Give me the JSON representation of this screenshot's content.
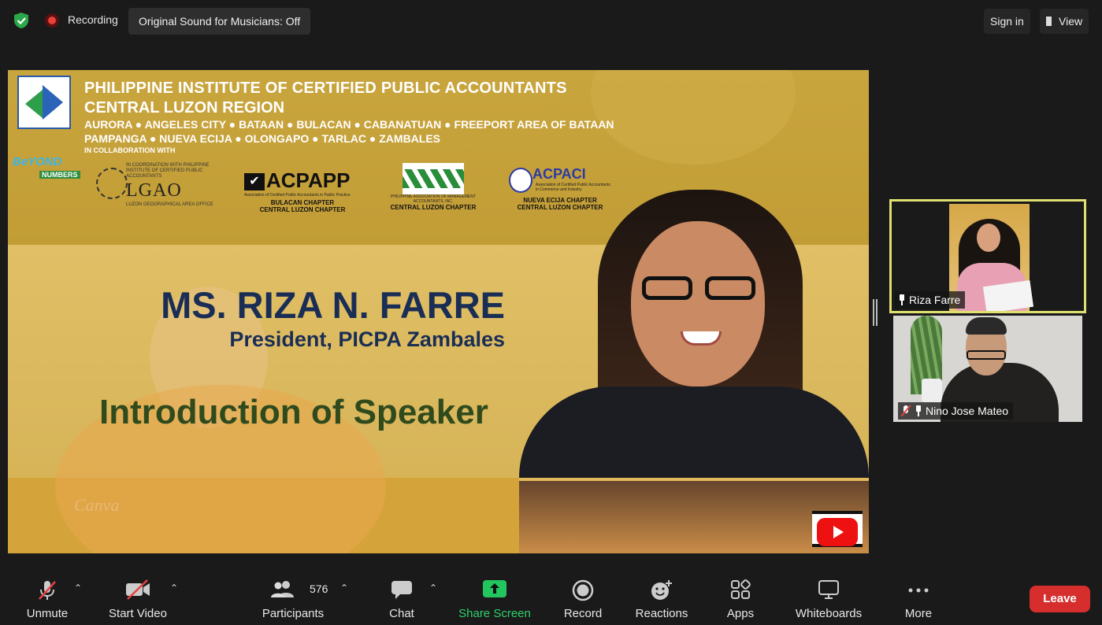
{
  "topbar": {
    "recording_label": "Recording",
    "original_sound": "Original Sound for Musicians: Off",
    "sign_in": "Sign in",
    "view": "View"
  },
  "slide": {
    "org_line1": "PHILIPPINE INSTITUTE OF CERTIFIED PUBLIC ACCOUNTANTS",
    "org_line2": "CENTRAL LUZON REGION",
    "chapters_line1": "AURORA ● ANGELES CITY ● BATAAN ● BULACAN ● CABANATUAN ● FREEPORT AREA OF BATAAN",
    "chapters_line2": "PAMPANGA ● NUEVA ECIJA ● OLONGAPO ● TARLAC ● ZAMBALES",
    "collab": "IN COLLABORATION WITH",
    "beyond": "BeYOND",
    "beyond_sub": "NUMBERS",
    "lgao_small": "IN COORDINATION WITH PHILIPPINE INSTITUTE OF CERTIFIED PUBLIC ACCOUNTANTS",
    "lgao": "LGAO",
    "lgao_sub": "LUZON GEOGRAPHICAL AREA OFFICE",
    "acpapp": "ACPAPP",
    "acpapp_small": "Association of Certified Public Accountants in Public Practice",
    "acpapp_chapter": "BULACAN CHAPTER\nCENTRAL LUZON CHAPTER",
    "pama_small": "PHILIPPINE ASSOCIATION OF MANAGEMENT ACCOUNTANTS, INC.",
    "pama_chapter": "CENTRAL LUZON CHAPTER",
    "acpaci": "ACPACI",
    "acpaci_small": "Association of Certified Public Accountants in Commerce and Industry",
    "acpaci_chapter": "NUEVA ECIJA CHAPTER\nCENTRAL LUZON CHAPTER",
    "speaker_name": "MS. RIZA N. FARRE",
    "speaker_role": "President, PICPA Zambales",
    "intro": "Introduction of Speaker",
    "canva": "Canva"
  },
  "participants_panel": [
    {
      "name": "Riza Farre"
    },
    {
      "name": "Nino Jose Mateo"
    }
  ],
  "toolbar": {
    "unmute": "Unmute",
    "start_video": "Start Video",
    "participants": "Participants",
    "participants_count": "576",
    "chat": "Chat",
    "share_screen": "Share Screen",
    "record": "Record",
    "reactions": "Reactions",
    "apps": "Apps",
    "whiteboards": "Whiteboards",
    "more": "More",
    "leave": "Leave"
  },
  "colors": {
    "share_green": "#22c55e",
    "leave_red": "#d62d2d",
    "active_speaker_border": "#e0e070"
  }
}
